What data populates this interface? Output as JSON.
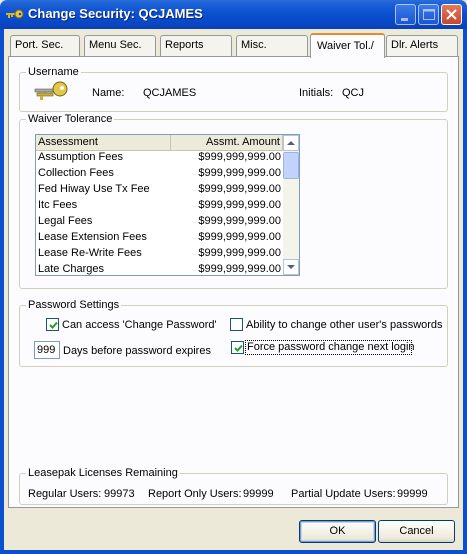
{
  "window": {
    "title": "Change Security: QCJAMES"
  },
  "tabs": [
    {
      "label": "Port. Sec."
    },
    {
      "label": "Menu Sec."
    },
    {
      "label": "Reports"
    },
    {
      "label": "Misc."
    },
    {
      "label": "Waiver Tol./"
    },
    {
      "label": "Dlr. Alerts"
    }
  ],
  "active_tab": "Waiver Tol./",
  "username_group": {
    "label": "Username",
    "name_label": "Name:",
    "name_value": "QCJAMES",
    "initials_label": "Initials:",
    "initials_value": "QCJ"
  },
  "waiver_group": {
    "label": "Waiver Tolerance",
    "columns": [
      "Assessment",
      "Assmt. Amount"
    ],
    "rows": [
      {
        "assessment": "Assumption Fees",
        "amount": "$999,999,999.00"
      },
      {
        "assessment": "Collection Fees",
        "amount": "$999,999,999.00"
      },
      {
        "assessment": "Fed Hiway Use Tx Fee",
        "amount": "$999,999,999.00"
      },
      {
        "assessment": "Itc Fees",
        "amount": "$999,999,999.00"
      },
      {
        "assessment": "Legal Fees",
        "amount": "$999,999,999.00"
      },
      {
        "assessment": "Lease Extension Fees",
        "amount": "$999,999,999.00"
      },
      {
        "assessment": "Lease Re-Write Fees",
        "amount": "$999,999,999.00"
      },
      {
        "assessment": "Late Charges",
        "amount": "$999,999,999.00"
      }
    ]
  },
  "password_group": {
    "label": "Password Settings",
    "can_access_label": "Can access 'Change Password'",
    "can_access_checked": true,
    "ability_label": "Ability to change other user's passwords",
    "ability_checked": false,
    "days_value": "999",
    "days_label": "Days before password expires",
    "force_label": "Force password change next login",
    "force_checked": true
  },
  "licenses_group": {
    "label": "Leasepak Licenses Remaining",
    "regular_label": "Regular Users:",
    "regular_value": "99973",
    "report_label": "Report Only Users:",
    "report_value": "99999",
    "partial_label": "Partial Update Users:",
    "partial_value": "99999"
  },
  "buttons": {
    "ok": "OK",
    "cancel": "Cancel"
  }
}
